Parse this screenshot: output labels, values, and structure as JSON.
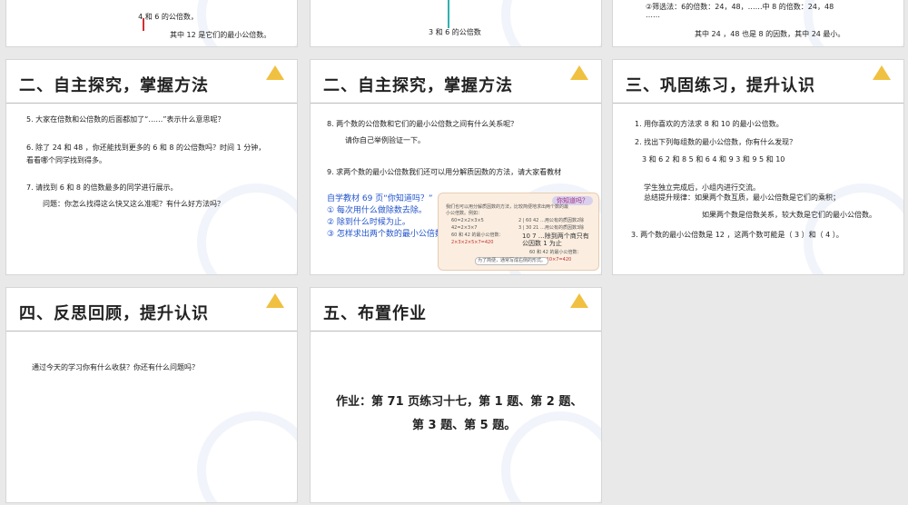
{
  "slides": [
    {
      "lines": [
        "4 和 6 的公倍数，",
        "其中 12 是它们的最小公倍数。"
      ]
    },
    {
      "lines": [
        "3 和 6 的公倍数"
      ]
    },
    {
      "lines": [
        "②筛选法：6的倍数：24，48，……中 8 的倍数：24，48",
        "……",
        "其中 24 ，48 也是 8 的因数，其中 24 最小。"
      ]
    },
    {
      "title": "二、自主探究，掌握方法",
      "lines": [
        "5. 大家在倍数和公倍数的后面都加了“……”表示什么意思呢？",
        "6. 除了 24 和 48 ，你还能找到更多的 6 和 8 的公倍数吗？时间 1 分钟，",
        "看看哪个同学找到得多。",
        "7. 请找到 6 和 8 的倍数最多的同学进行展示。",
        "问题：你怎么找得这么快又这么准呢？有什么好方法吗？"
      ]
    },
    {
      "title": "二、自主探究，掌握方法",
      "lines": [
        "8. 两个数的公倍数和它们的最小公倍数之间有什么关系呢？",
        "请你自己举例验证一下。",
        "9. 求两个数的最小公倍数我们还可以用分解质因数的方法，请大家看教材"
      ],
      "blue": [
        "自学教材 69 页“你知道吗？”",
        "① 每次用什么做除数去除。",
        "② 除到什么时候为止。",
        "③ 怎样求出两个数的最小公倍数。"
      ],
      "box": {
        "badge": "你知道吗？",
        "lines": [
          "我们也可以用分解质因数的方法，比较简便地求出两个数的最",
          "小公倍数。例如：",
          "60=2×2×3×5",
          "42=2×3×7",
          "60 和 42 的最小公倍数：",
          "2×3×2×5×7=420",
          "2 | 60  42 …用公有的质因数2除",
          "3 | 30  21 …用公有的质因数3除",
          "10  7 …除到两个商只有公因数 1 为止",
          "60 和 42 的最小公倍数：",
          "2×3×10×7=420",
          "为了简便，通常写成右侧的形式。"
        ]
      }
    },
    {
      "title": "三、巩固练习，提升认识",
      "lines": [
        "1. 用你喜欢的方法求 8 和 10 的最小公倍数。",
        "2. 找出下列每组数的最小公倍数，你有什么发现？",
        "3 和 6     2 和 8     5 和 6     4 和 9     3 和 9     5 和 10",
        "学生独立完成后，小组内进行交流。",
        "总结提升规律：如果两个数互质，最小公倍数是它们的乘积；",
        "如果两个数是倍数关系，较大数是它们的最小公倍数。",
        "3. 两个数的最小公倍数是 12 ，这两个数可能是（ 3    ）和（ 4    ）。"
      ]
    },
    {
      "title": "四、反思回顾，提升认识",
      "lines": [
        "通过今天的学习你有什么收获？你还有什么问题吗？"
      ]
    },
    {
      "title": "五、布置作业",
      "lines": [
        "作业：第 71 页练习十七，第 1 题、第 2 题、",
        "第 3 题、第 5 题。"
      ]
    }
  ],
  "colors": {
    "background": "#e9e9e9",
    "blue_text": "#2255cc",
    "arrow": "#30b0b0"
  }
}
